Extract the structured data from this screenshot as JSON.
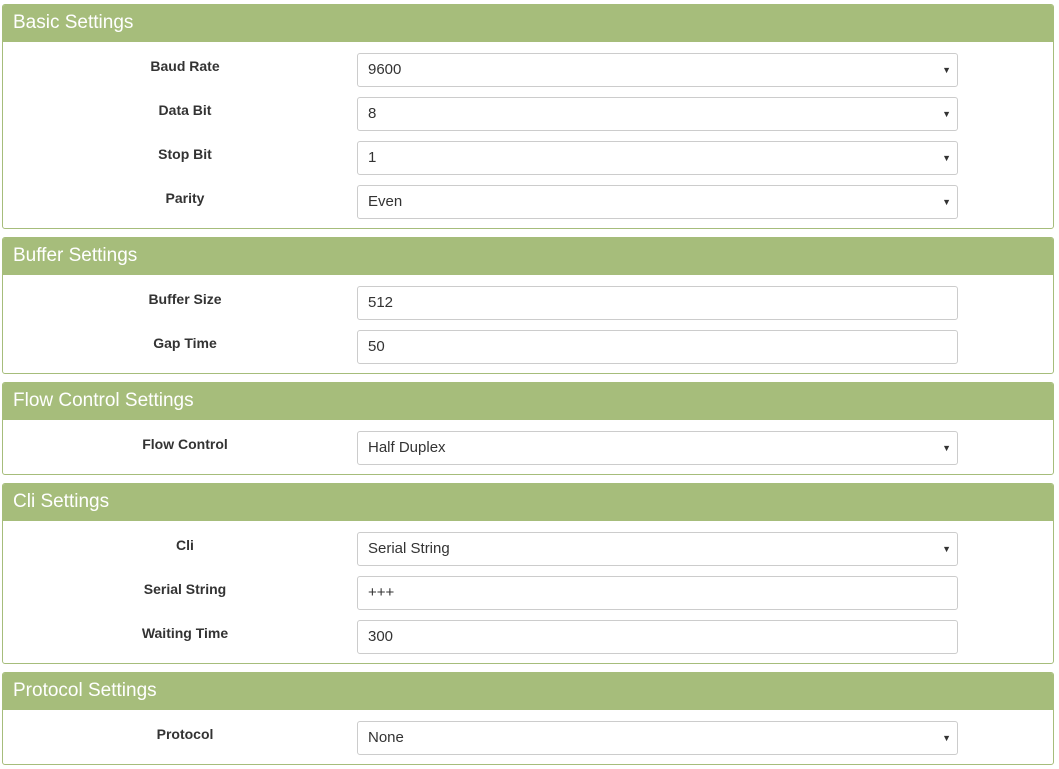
{
  "sections": {
    "basic": {
      "title": "Basic Settings",
      "baud_rate": {
        "label": "Baud Rate",
        "value": "9600"
      },
      "data_bit": {
        "label": "Data Bit",
        "value": "8"
      },
      "stop_bit": {
        "label": "Stop Bit",
        "value": "1"
      },
      "parity": {
        "label": "Parity",
        "value": "Even"
      }
    },
    "buffer": {
      "title": "Buffer Settings",
      "buffer_size": {
        "label": "Buffer Size",
        "value": "512"
      },
      "gap_time": {
        "label": "Gap Time",
        "value": "50"
      }
    },
    "flow": {
      "title": "Flow Control Settings",
      "flow_control": {
        "label": "Flow Control",
        "value": "Half Duplex"
      }
    },
    "cli": {
      "title": "Cli Settings",
      "cli": {
        "label": "Cli",
        "value": "Serial String"
      },
      "serial_string": {
        "label": "Serial String",
        "value": "+++"
      },
      "waiting_time": {
        "label": "Waiting Time",
        "value": "300"
      }
    },
    "protocol": {
      "title": "Protocol Settings",
      "protocol": {
        "label": "Protocol",
        "value": "None"
      }
    }
  },
  "icons": {
    "dropdown": "caret-down-icon"
  },
  "colors": {
    "header_bg": "#a6bd7b",
    "header_text": "#ffffff"
  }
}
